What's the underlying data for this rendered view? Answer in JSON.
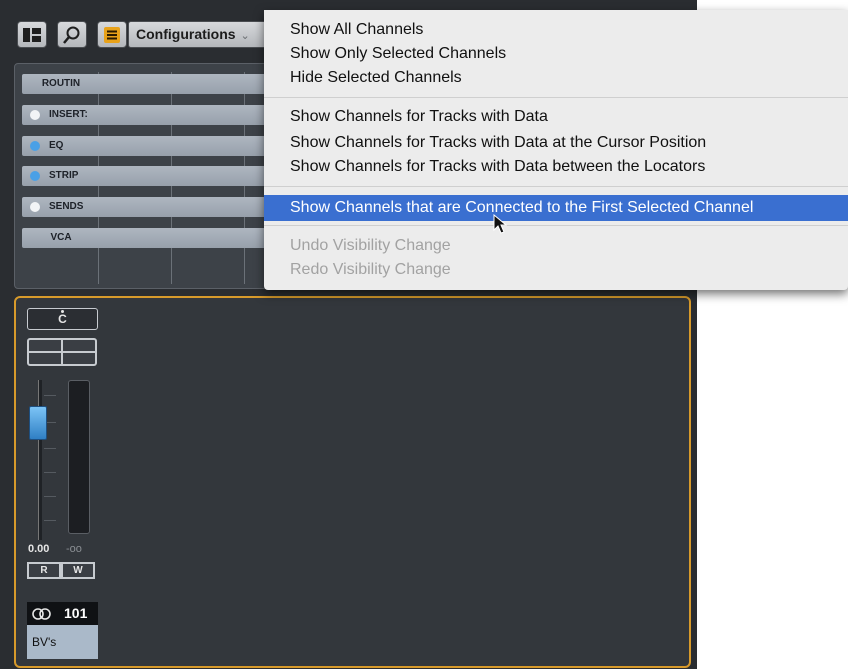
{
  "toolbar": {
    "configurations_label": "Configurations",
    "dropdown_glyph": "⌄",
    "icons": [
      "layout-icon",
      "search-icon",
      "configurations-icon"
    ]
  },
  "racks": [
    {
      "label": "ROUTIN",
      "led": ""
    },
    {
      "label": "INSERT:",
      "led": "white"
    },
    {
      "label": "EQ",
      "led": "blue"
    },
    {
      "label": "STRIP",
      "led": "blue"
    },
    {
      "label": "SENDS",
      "led": "white"
    },
    {
      "label": "VCA",
      "led": ""
    }
  ],
  "channel": {
    "pan": "C",
    "volume": "0.00",
    "meter_peak": "-oo",
    "read_label": "R",
    "write_label": "W",
    "number": "101",
    "name": "BV's"
  },
  "menu": {
    "group1": [
      "Show All Channels",
      "Show Only Selected Channels",
      "Hide Selected Channels"
    ],
    "group2": [
      "Show Channels for Tracks with Data",
      "Show Channels for Tracks with Data at the Cursor Position",
      "Show Channels for Tracks with Data between the Locators"
    ],
    "highlighted": "Show Channels that are Connected to the First Selected Channel",
    "group3": [
      "Undo Visibility Change",
      "Redo Visibility Change"
    ]
  },
  "colors": {
    "highlight": "#3a6fd0",
    "accent_orange": "#d79a2b",
    "led_blue": "#4aa0e6",
    "fader_blue": "#3d95dc"
  }
}
